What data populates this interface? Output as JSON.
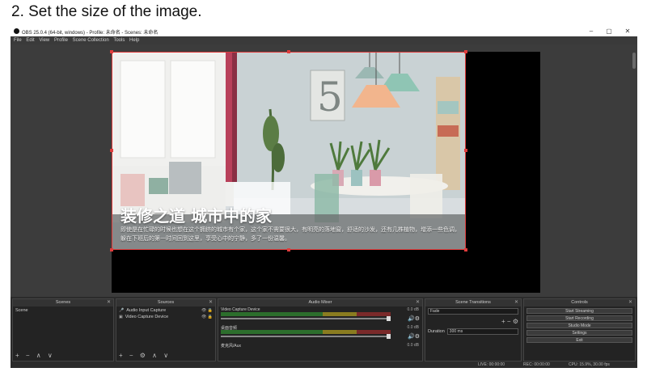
{
  "caption": "2. Set the size of the image.",
  "window": {
    "title": "OBS 25.0.4 (64-bit, windows) - Profile: 未命名 - Scenes: 未命名",
    "minimize": "–",
    "maximize": "▢",
    "close": "✕"
  },
  "menu": [
    "File",
    "Edit",
    "View",
    "Profile",
    "Scene Collection",
    "Tools",
    "Help"
  ],
  "preview": {
    "headline": "装修之道  城市中的家",
    "subtext": "即使是在忙碌的时候也想在这个拥挤的城市有个家，这个家不需要很大，有明亮的落地窗，舒适的沙发，还有几株植物，增添一些色调，躲在下班后的第一时间回到这里，享受心中的宁静，多了一份温馨。",
    "number_art": "5"
  },
  "docks": {
    "scenes": {
      "title": "Scenes",
      "items": [
        "Scene"
      ],
      "footer": "+ − ∧ ∨"
    },
    "sources": {
      "title": "Sources",
      "items": [
        "Audio Input Capture",
        "Video Capture Device"
      ],
      "footer": "+ − ⚙ ∧ ∨"
    },
    "mixer": {
      "title": "Audio Mixer",
      "rows": [
        {
          "name": "Video Capture Device",
          "db": "0.0 dB"
        },
        {
          "name": "桌面音频",
          "db": "0.0 dB"
        },
        {
          "name": "麦克风/Aux",
          "db": "0.0 dB"
        }
      ]
    },
    "transitions": {
      "title": "Scene Transitions",
      "type_value": "Fade",
      "duration_label": "Duration",
      "duration_value": "300 ms"
    },
    "controls": {
      "title": "Controls",
      "buttons": [
        "Start Streaming",
        "Start Recording",
        "Studio Mode",
        "Settings",
        "Exit"
      ]
    }
  },
  "status": {
    "live": "LIVE: 00:00:00",
    "rec": "REC: 00:00:00",
    "cpu": "CPU: 15.9%, 30.00 fps"
  },
  "colors": {
    "selection": "#e03c3c",
    "panel": "#2b2b2b"
  }
}
